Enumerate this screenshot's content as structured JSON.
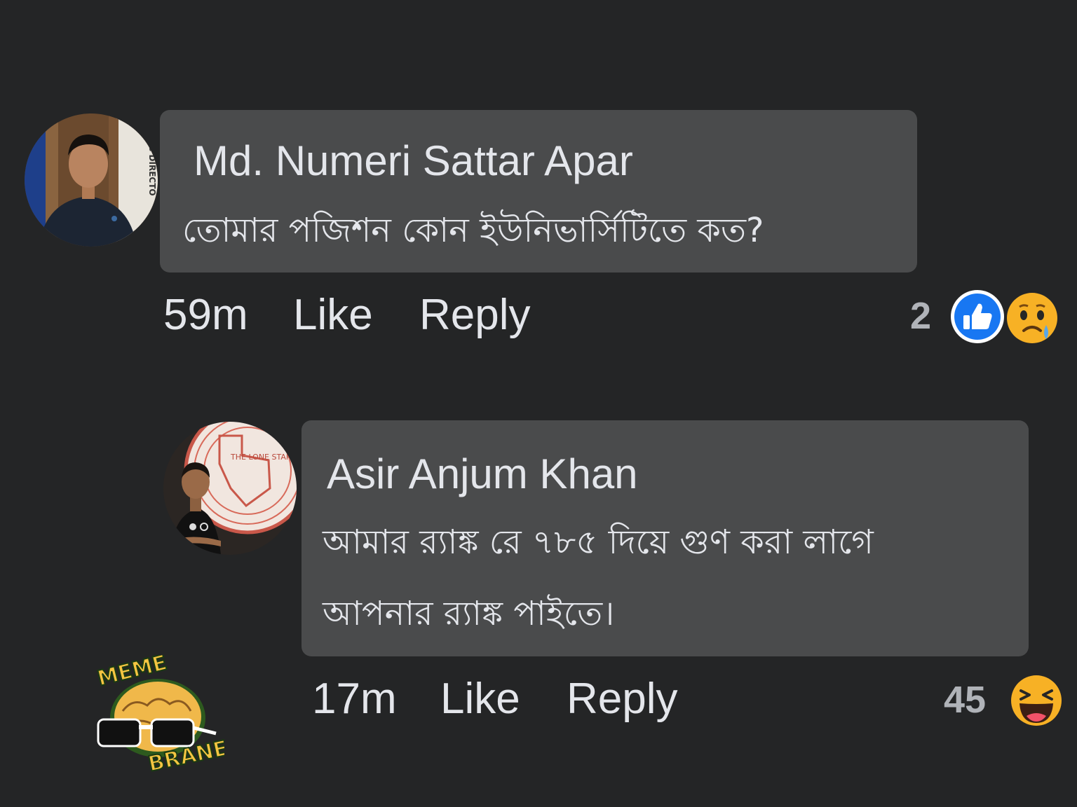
{
  "comments": [
    {
      "author": "Md. Numeri Sattar Apar",
      "text_lines": [
        "তোমার পজিশন কোন ইউনিভার্সিটিতে কত?"
      ],
      "time": "59m",
      "like_label": "Like",
      "reply_label": "Reply",
      "reaction_count": "2",
      "reactions": [
        "like-icon",
        "sad-icon"
      ],
      "avatar_text": "ING DIRECTO"
    },
    {
      "author": "Asir Anjum Khan",
      "text_lines": [
        "আমার র‍্যাঙ্ক রে ৭৮৫ দিয়ে গুণ করা লাগে",
        "আপনার র‍্যাঙ্ক পাইতে।"
      ],
      "time": "17m",
      "like_label": "Like",
      "reply_label": "Reply",
      "reaction_count": "45",
      "reactions": [
        "haha-icon"
      ],
      "avatar_text": "THE LONE STAR"
    }
  ],
  "watermark": {
    "top": "MEME",
    "bottom": "BRANE"
  },
  "colors": {
    "background": "#242526",
    "bubble": "#4a4b4c",
    "text": "#e4e6eb",
    "count": "#b0b3b8",
    "like_blue": "#1877f2",
    "emoji_yellow": "#f7b125"
  }
}
